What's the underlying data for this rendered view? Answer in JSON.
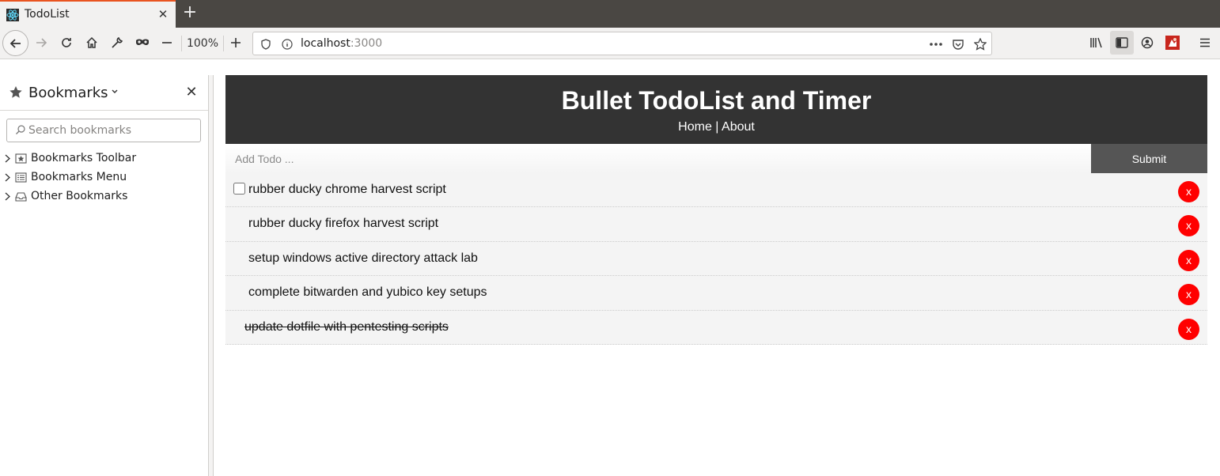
{
  "browser": {
    "tab": {
      "title": "TodoList",
      "favicon": "react-icon"
    },
    "zoom": "100%",
    "url": {
      "host": "localhost",
      "port": ":3000"
    }
  },
  "sidebar": {
    "title": "Bookmarks",
    "search_placeholder": "Search bookmarks",
    "items": [
      {
        "label": "Bookmarks Toolbar",
        "icon": "bookmarks-toolbar-icon"
      },
      {
        "label": "Bookmarks Menu",
        "icon": "bookmarks-menu-icon"
      },
      {
        "label": "Other Bookmarks",
        "icon": "other-bookmarks-icon"
      }
    ]
  },
  "app": {
    "title": "Bullet TodoList and Timer",
    "nav": {
      "home": "Home",
      "separator": " | ",
      "about": "About"
    },
    "form": {
      "placeholder": "Add Todo ...",
      "submit": "Submit"
    },
    "delete_label": "x",
    "todos": [
      {
        "text": "rubber ducky chrome harvest script",
        "completed": false
      },
      {
        "text": "rubber ducky firefox harvest script",
        "completed": false
      },
      {
        "text": "setup windows active directory attack lab",
        "completed": false
      },
      {
        "text": "complete bitwarden and yubico key setups",
        "completed": false
      },
      {
        "text": "update dotfile with pentesting scripts",
        "completed": true
      }
    ]
  },
  "colors": {
    "header_bg": "#333333",
    "delete_button": "#ff0000",
    "submit_bg": "#555555",
    "tab_accent": "#e95420"
  }
}
